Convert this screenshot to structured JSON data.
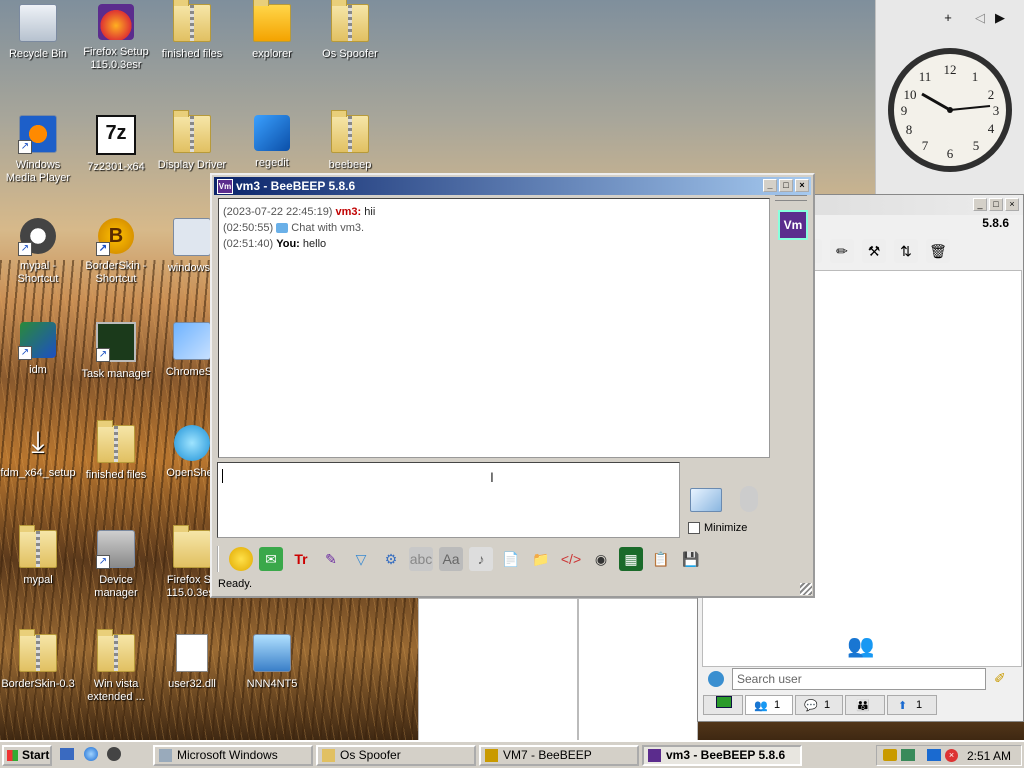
{
  "desktop": {
    "icons": [
      {
        "label": "Recycle Bin",
        "icon": "recycle-bin-icon"
      },
      {
        "label": "Firefox Setup 115.0.3esr",
        "icon": "firefox-setup-icon"
      },
      {
        "label": "finished files",
        "icon": "folder-zip-icon"
      },
      {
        "label": "explorer",
        "icon": "folder-icon"
      },
      {
        "label": "Os Spoofer",
        "icon": "folder-zip-icon"
      },
      {
        "label": "Windows Media Player",
        "icon": "media-player-icon"
      },
      {
        "label": "7z2301-x64",
        "icon": "7zip-icon"
      },
      {
        "label": "Display Driver",
        "icon": "folder-zip-icon"
      },
      {
        "label": "regedit",
        "icon": "regedit-icon"
      },
      {
        "label": "beebeep",
        "icon": "folder-zip-icon"
      },
      {
        "label": "mypal - Shortcut",
        "icon": "mypal-icon"
      },
      {
        "label": "BorderSkin - Shortcut",
        "icon": "borderskin-icon"
      },
      {
        "label": "windows6",
        "icon": "windows-update-icon"
      },
      {
        "label": "idm",
        "icon": "idm-icon"
      },
      {
        "label": "Task manager",
        "icon": "task-manager-icon"
      },
      {
        "label": "ChromeSe",
        "icon": "chrome-setup-icon"
      },
      {
        "label": "fdm_x64_setup",
        "icon": "download-icon"
      },
      {
        "label": "finished files",
        "icon": "folder-zip-icon"
      },
      {
        "label": "OpenShell",
        "icon": "openshell-icon"
      },
      {
        "label": "mypal",
        "icon": "folder-zip-icon"
      },
      {
        "label": "Device manager",
        "icon": "device-manager-icon"
      },
      {
        "label": "Firefox Se 115.0.3esr",
        "icon": "folder-icon"
      },
      {
        "label": "BorderSkin-0.3",
        "icon": "folder-zip-icon"
      },
      {
        "label": "Win vista extended ...",
        "icon": "folder-zip-icon"
      },
      {
        "label": "user32.dll",
        "icon": "dll-icon"
      },
      {
        "label": "NNN4NT5",
        "icon": "network-setup-icon"
      }
    ]
  },
  "sidebar": {
    "add": "+",
    "prev": "◁",
    "next": "▶"
  },
  "beebeep_bg": {
    "version": "5.8.6",
    "search_placeholder": "Search user",
    "tabs": [
      "1",
      "1",
      "1"
    ]
  },
  "chat_window": {
    "title": "vm3 - BeeBEEP 5.8.6",
    "app_icon_text": "Vm",
    "avatar_text": "Vm",
    "messages": [
      {
        "time": "(2023-07-22 22:45:19)",
        "sender": "vm3:",
        "text": "hii",
        "type": "remote"
      },
      {
        "time": "(02:50:55)",
        "sender": "",
        "text": "Chat with vm3.",
        "type": "system"
      },
      {
        "time": "(02:51:40)",
        "sender": "You:",
        "text": "hello",
        "type": "self"
      }
    ],
    "minimize_label": "Minimize",
    "status": "Ready."
  },
  "taskbar": {
    "start": "Start",
    "tasks": [
      {
        "label": "Microsoft Windows",
        "active": false
      },
      {
        "label": "Os Spoofer",
        "active": false
      },
      {
        "label": "VM7 - BeeBEEP",
        "active": false
      },
      {
        "label": "vm3 - BeeBEEP 5.8.6",
        "active": true
      }
    ],
    "clock": "2:51 AM"
  },
  "colors": {
    "titlebar_start": "#0a246a",
    "titlebar_end": "#a6caf0",
    "remote_nick": "#c00000",
    "avatar_bg": "#5b2c8d"
  }
}
